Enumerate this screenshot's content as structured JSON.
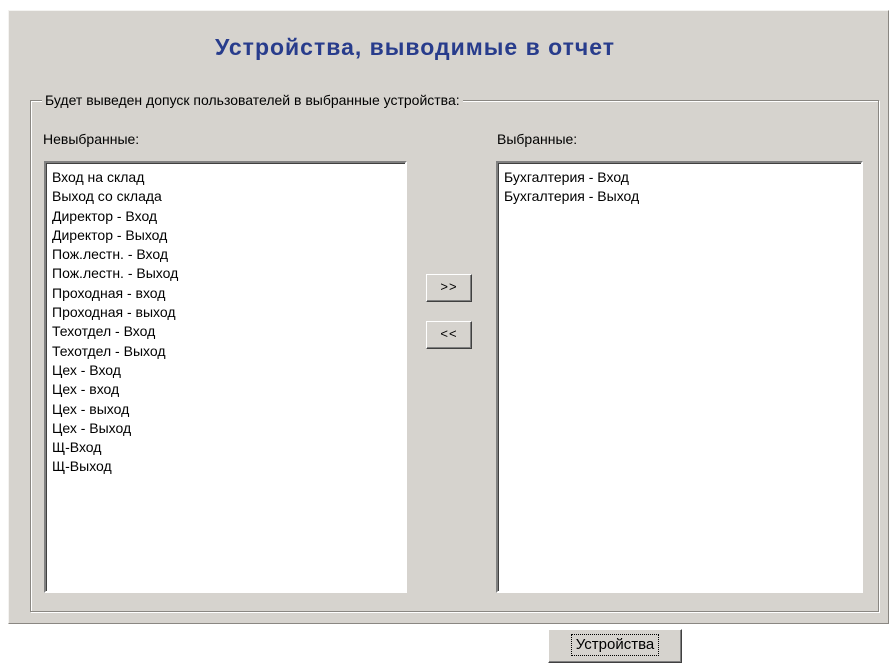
{
  "title": "Устройства, выводимые в отчет",
  "group_label": "Будет выведен допуск пользователей в выбранные устройства:",
  "unselected": {
    "label": "Невыбранные:",
    "items": [
      "Вход на склад",
      "Выход со склада",
      "Директор - Вход",
      "Директор - Выход",
      "Пож.лестн. - Вход",
      "Пож.лестн. - Выход",
      "Проходная - вход",
      "Проходная - выход",
      "Техотдел - Вход",
      "Техотдел - Выход",
      "Цех - Вход",
      "Цех - вход",
      "Цех - выход",
      "Цех - Выход",
      "Щ-Вход",
      "Щ-Выход"
    ]
  },
  "selected": {
    "label": "Выбранные:",
    "items": [
      "Бухгалтерия - Вход",
      "Бухгалтерия - Выход"
    ]
  },
  "buttons": {
    "add_label": ">>",
    "remove_label": "<<",
    "devices_label": "Устройства"
  }
}
